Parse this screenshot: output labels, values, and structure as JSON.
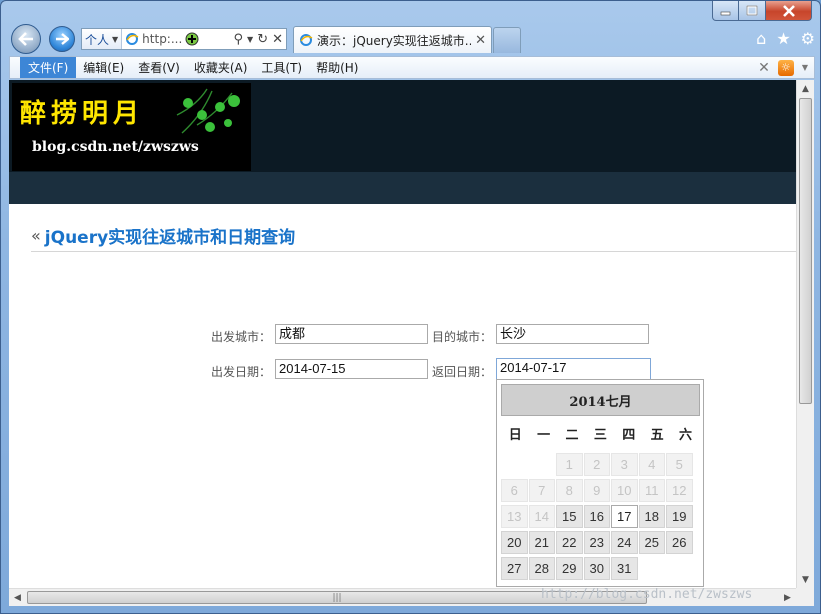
{
  "browser": {
    "address_dropdown": "个人",
    "address_url": "http:...",
    "tab_title": "演示：jQuery实现往返城市...",
    "menu": [
      "文件(F)",
      "编辑(E)",
      "查看(V)",
      "收藏夹(A)",
      "工具(T)",
      "帮助(H)"
    ]
  },
  "banner": {
    "logo_title": "醉捞明月",
    "logo_subtitle": "blog.csdn.net/zwszws"
  },
  "page": {
    "title": "jQuery实现往返城市和日期查询"
  },
  "form": {
    "depart_city_label": "出发城市：",
    "depart_city_value": "成都",
    "dest_city_label": "目的城市：",
    "dest_city_value": "长沙",
    "depart_date_label": "出发日期：",
    "depart_date_value": "2014-07-15",
    "return_date_label": "返回日期：",
    "return_date_value": "2014-07-17"
  },
  "datepicker": {
    "header": "2014七月",
    "weekdays": [
      "日",
      "一",
      "二",
      "三",
      "四",
      "五",
      "六"
    ],
    "rows": [
      [
        "",
        "",
        "1",
        "2",
        "3",
        "4",
        "5"
      ],
      [
        "6",
        "7",
        "8",
        "9",
        "10",
        "11",
        "12"
      ],
      [
        "13",
        "14",
        "15",
        "16",
        "17",
        "18",
        "19"
      ],
      [
        "20",
        "21",
        "22",
        "23",
        "24",
        "25",
        "26"
      ],
      [
        "27",
        "28",
        "29",
        "30",
        "31",
        "",
        ""
      ]
    ]
  },
  "watermark": "http://blog.csdn.net/zwszws"
}
